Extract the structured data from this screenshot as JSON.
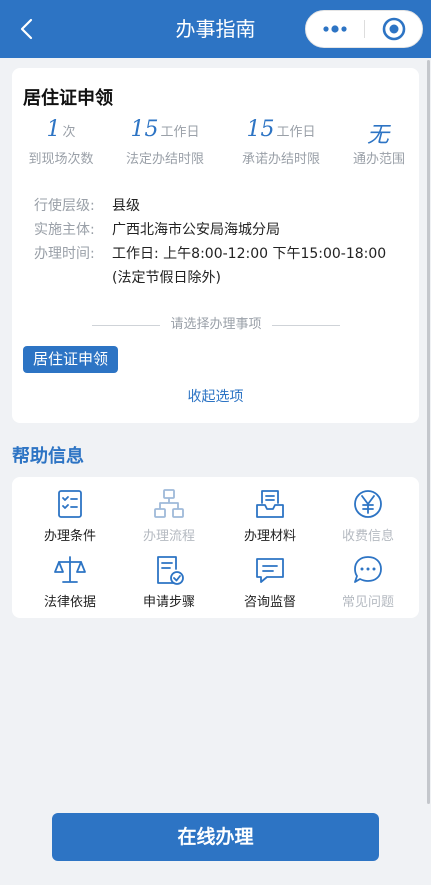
{
  "nav": {
    "title": "办事指南",
    "back_icon": "chevron-left-icon",
    "more_icon": "more-dots-icon",
    "close_icon": "target-close-icon",
    "bg_color": "#2d74c4"
  },
  "service": {
    "title": "居住证申领",
    "stats": [
      {
        "value": "1",
        "unit": "次",
        "label": "到现场次数"
      },
      {
        "value": "15",
        "unit": "工作日",
        "label": "法定办结时限"
      },
      {
        "value": "15",
        "unit": "工作日",
        "label": "承诺办结时限"
      },
      {
        "value": "无",
        "unit": "",
        "label": "通办范围"
      }
    ],
    "info": {
      "level_label": "行使层级:",
      "level_value": "县级",
      "subject_label": "实施主体:",
      "subject_value": "广西北海市公安局海城分局",
      "time_label": "办理时间:",
      "time_value_line1": "工作日: 上午8:00-12:00 下午15:00-18:00",
      "time_value_line2": "(法定节假日除外)"
    },
    "select_prompt": "请选择办理事项",
    "selected_item": "居住证申领",
    "collapse_label": "收起选项"
  },
  "help": {
    "title": "帮助信息",
    "items": [
      {
        "label": "办理条件",
        "icon": "checklist-icon",
        "enabled": true
      },
      {
        "label": "办理流程",
        "icon": "flowchart-icon",
        "enabled": false
      },
      {
        "label": "办理材料",
        "icon": "inbox-document-icon",
        "enabled": true
      },
      {
        "label": "收费信息",
        "icon": "yen-icon",
        "enabled": false
      },
      {
        "label": "法律依据",
        "icon": "scales-icon",
        "enabled": true
      },
      {
        "label": "申请步骤",
        "icon": "document-check-icon",
        "enabled": true
      },
      {
        "label": "咨询监督",
        "icon": "message-square-icon",
        "enabled": true
      },
      {
        "label": "常见问题",
        "icon": "chat-bubble-icon",
        "enabled": false
      }
    ]
  },
  "footer": {
    "online_button": "在线办理"
  }
}
